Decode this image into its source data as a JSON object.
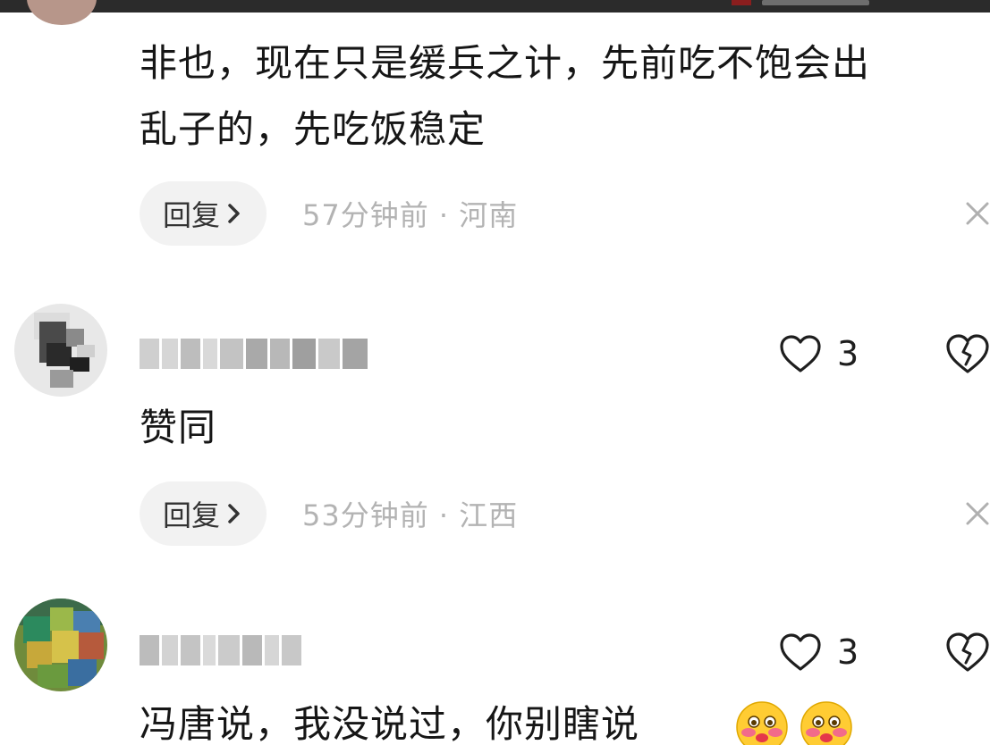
{
  "previous_comment": {
    "lines": [
      "非也，现在只是缓兵之计，先前吃不饱会出",
      "乱子的，先吃饭稳定"
    ],
    "reply_label": "回复",
    "meta": "57分钟前 · 河南"
  },
  "comments": [
    {
      "text": "赞同",
      "likes": "3",
      "reply_label": "回复",
      "meta": "53分钟前 · 江西"
    },
    {
      "text": "冯唐说，我没说过，你别瞎说",
      "likes": "3"
    }
  ],
  "icons": {
    "chevron": "chevron-right-icon",
    "close": "close-icon",
    "heart": "heart-outline-icon",
    "dislike": "broken-heart-outline-icon",
    "emoji": "blushing-face-emoji-icon"
  },
  "colors": {
    "text": "#161616",
    "meta": "#b3b3b3",
    "pill": "#f2f2f2"
  }
}
